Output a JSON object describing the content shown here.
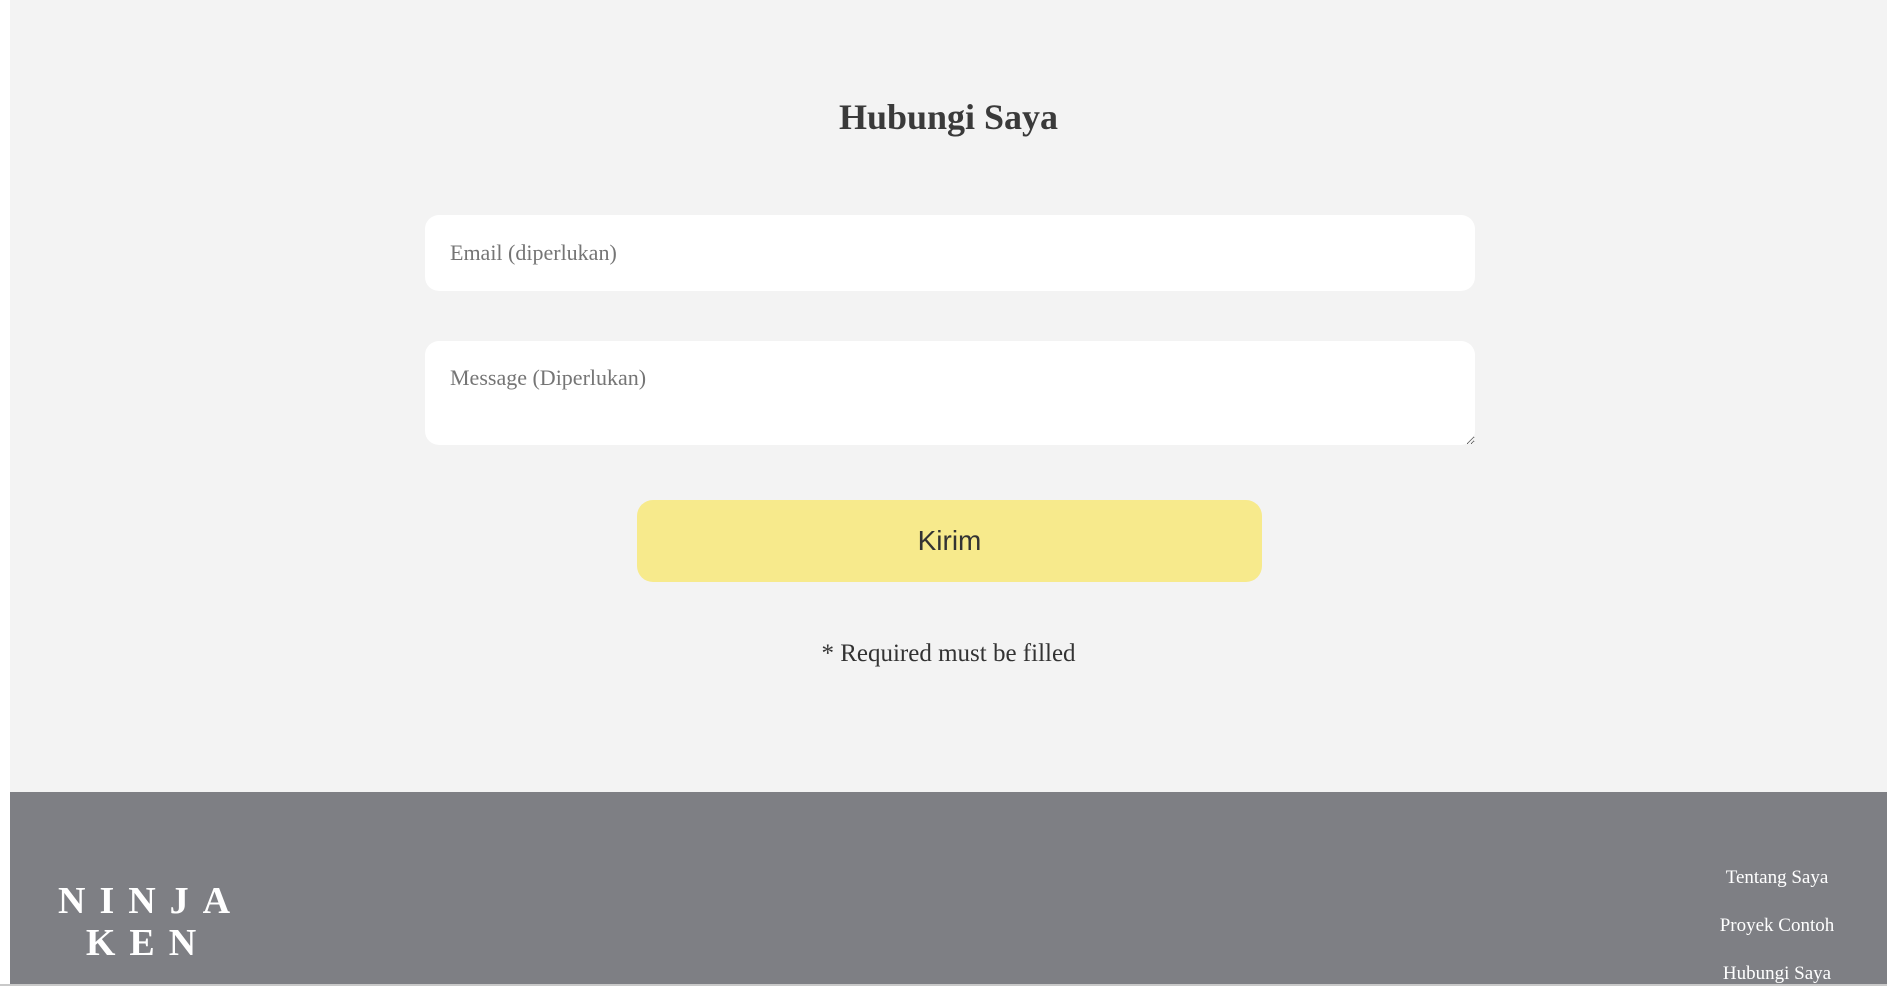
{
  "contact": {
    "title": "Hubungi Saya",
    "email_placeholder": "Email (diperlukan)",
    "message_placeholder": "Message (Diperlukan)",
    "submit_label": "Kirim",
    "required_note": "* Required must be filled"
  },
  "footer": {
    "logo_line1": "NINJA",
    "logo_line2": "KEN",
    "links": [
      {
        "label": "Tentang Saya"
      },
      {
        "label": "Proyek Contoh"
      },
      {
        "label": "Hubungi Saya"
      }
    ]
  },
  "colors": {
    "section_bg": "#f3f3f3",
    "button_bg": "#f7ea8c",
    "footer_bg": "#7e7f84",
    "text": "#3a3a3a"
  },
  "icons": {
    "resize": "resize-handle-icon"
  }
}
